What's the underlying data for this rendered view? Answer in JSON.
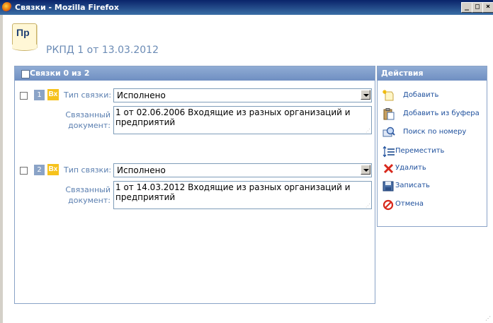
{
  "window": {
    "title": "Связки - Mozilla Firefox",
    "btn_min": "_",
    "btn_max": "□",
    "btn_close": "×"
  },
  "document": {
    "badge": "Пр",
    "title": "РКПД 1 от 13.03.2012"
  },
  "links_panel": {
    "title": "Связки 0 из 2",
    "type_label": "Тип связки:",
    "doc_label": "Связанный документ:",
    "rows": [
      {
        "num": "1",
        "badge": "Вх",
        "type_value": "Исполнено",
        "doc_value": "1 от 02.06.2006 Входящие из разных организаций и предприятий"
      },
      {
        "num": "2",
        "badge": "Вх",
        "type_value": "Исполнено",
        "doc_value": "1 от 14.03.2012 Входящие из разных организаций и предприятий"
      }
    ]
  },
  "actions_panel": {
    "title": "Действия",
    "items": [
      {
        "label": "Добавить",
        "icon": "add-icon"
      },
      {
        "label": "Добавить из буфера",
        "icon": "paste-icon"
      },
      {
        "label": "Поиск по номеру",
        "icon": "search-number-icon"
      },
      {
        "label": "Переместить",
        "icon": "move-icon"
      },
      {
        "label": "Удалить",
        "icon": "delete-icon"
      },
      {
        "label": "Записать",
        "icon": "save-icon"
      },
      {
        "label": "Отмена",
        "icon": "cancel-icon"
      }
    ]
  }
}
